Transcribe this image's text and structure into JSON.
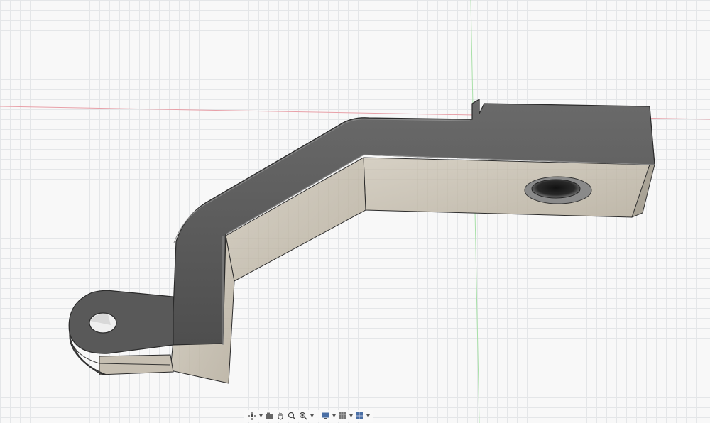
{
  "app": {
    "name": "3D CAD viewport"
  },
  "viewport": {
    "background_color": "#f8f8f8",
    "grid_color": "#e4e6e8",
    "x_axis_color": "#e8a0a8",
    "y_axis_color": "#a8e0a8",
    "model_top_color": "#5b5b5b",
    "model_side_color": "#ccc5b8"
  },
  "nav_bar": {
    "tools": [
      {
        "name": "orbit",
        "icon": "orbit-icon",
        "has_dropdown": true
      },
      {
        "name": "look-at",
        "icon": "camera-icon",
        "has_dropdown": false
      },
      {
        "name": "pan",
        "icon": "hand-icon",
        "has_dropdown": false
      },
      {
        "name": "zoom",
        "icon": "zoom-icon",
        "has_dropdown": false
      },
      {
        "name": "fit",
        "icon": "zoom-window-icon",
        "has_dropdown": true
      },
      {
        "name": "display-settings",
        "icon": "display-icon",
        "has_dropdown": true
      },
      {
        "name": "grid-snaps",
        "icon": "grid-icon",
        "has_dropdown": true
      },
      {
        "name": "viewports",
        "icon": "viewports-icon",
        "has_dropdown": true
      }
    ]
  }
}
